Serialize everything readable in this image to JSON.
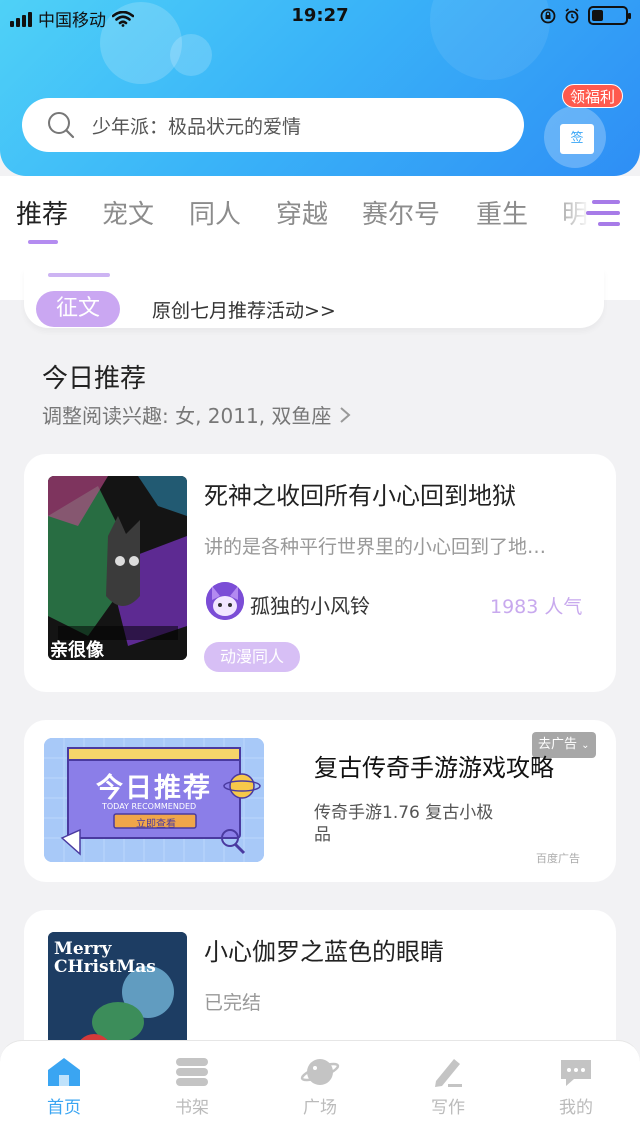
{
  "status_bar": {
    "carrier": "中国移动",
    "time": "19:27"
  },
  "search": {
    "placeholder": "少年派：极品状元的爱情"
  },
  "gift": {
    "badge": "领福利",
    "box_label": "签"
  },
  "tabs": [
    {
      "label": "推荐",
      "active": true
    },
    {
      "label": "宠文"
    },
    {
      "label": "同人"
    },
    {
      "label": "穿越"
    },
    {
      "label": "赛尔号"
    },
    {
      "label": "重生"
    },
    {
      "label": "明星"
    }
  ],
  "notice": {
    "tag": "征文",
    "text": "原创七月推荐活动>>"
  },
  "section": {
    "title": "今日推荐",
    "subtitle": "调整阅读兴趣: 女, 2011, 双鱼座"
  },
  "books": [
    {
      "title": "死神之收回所有小心回到地狱",
      "desc": "讲的是各种平行世界里的小心回到了地…",
      "author": "孤独的小风铃",
      "popularity": "1983 人气",
      "genre": "动漫同人",
      "cover_text": "亲很像"
    },
    {
      "title": "小心伽罗之蓝色的眼睛",
      "desc": "已完结",
      "cover_text": "Merry CHristMas"
    }
  ],
  "ad": {
    "close_label": "去广告",
    "title": "复古传奇手游游戏攻略",
    "desc": "传奇手游1.76 复古小极品",
    "source": "百度广告",
    "banner_title": "今日推荐",
    "banner_sub": "TODAY RECOMMENDED",
    "banner_button": "立即查看"
  },
  "bottom_nav": [
    {
      "label": "首页",
      "active": true
    },
    {
      "label": "书架"
    },
    {
      "label": "广场"
    },
    {
      "label": "写作"
    },
    {
      "label": "我的"
    }
  ],
  "colors": {
    "accent": "#3aa5f2",
    "purple": "#b48cf0",
    "badge_red": "#ff5a4e"
  }
}
